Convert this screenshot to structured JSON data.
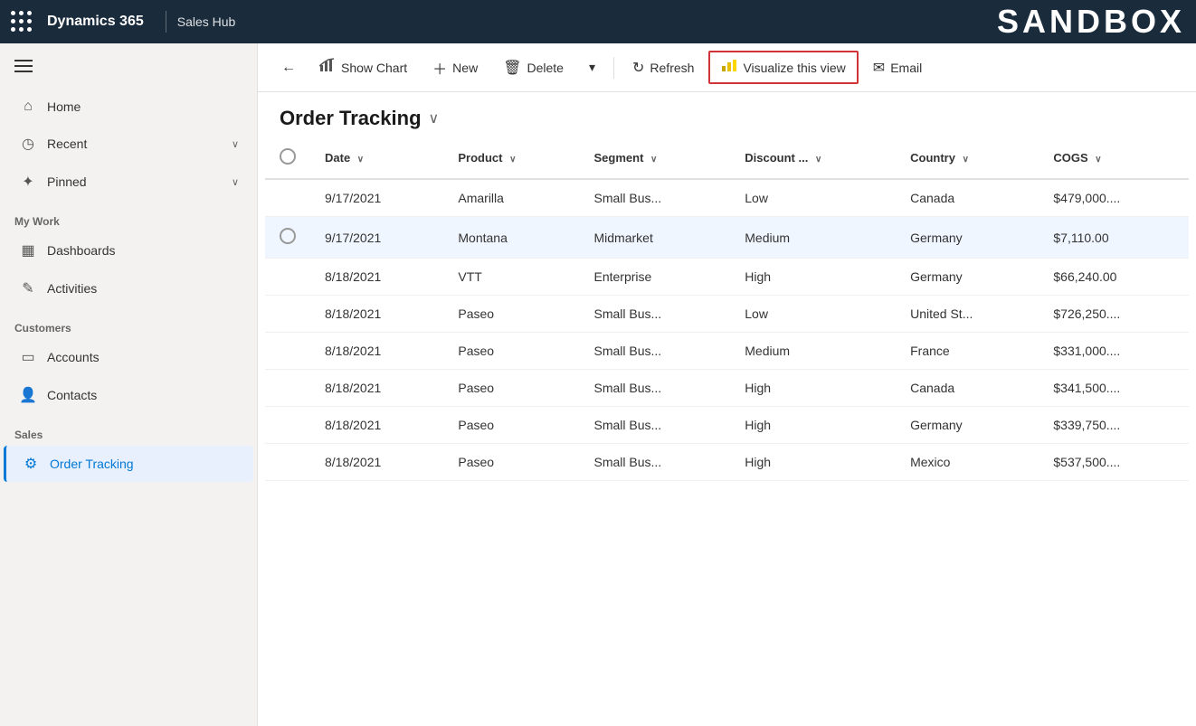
{
  "topbar": {
    "app_name": "Dynamics 365",
    "module_name": "Sales Hub",
    "sandbox_label": "SANDBOX"
  },
  "sidebar": {
    "hamburger_label": "Menu",
    "items": [
      {
        "id": "home",
        "label": "Home",
        "icon": "⌂",
        "has_chevron": false
      },
      {
        "id": "recent",
        "label": "Recent",
        "icon": "◷",
        "has_chevron": true
      },
      {
        "id": "pinned",
        "label": "Pinned",
        "icon": "✦",
        "has_chevron": true
      }
    ],
    "my_work_label": "My Work",
    "my_work_items": [
      {
        "id": "dashboards",
        "label": "Dashboards",
        "icon": "▦",
        "has_chevron": false
      },
      {
        "id": "activities",
        "label": "Activities",
        "icon": "✎",
        "has_chevron": false
      }
    ],
    "customers_label": "Customers",
    "customers_items": [
      {
        "id": "accounts",
        "label": "Accounts",
        "icon": "▭",
        "has_chevron": false
      },
      {
        "id": "contacts",
        "label": "Contacts",
        "icon": "👤",
        "has_chevron": false
      }
    ],
    "sales_label": "Sales",
    "sales_items": [
      {
        "id": "order-tracking",
        "label": "Order Tracking",
        "icon": "⚙",
        "is_active": true
      }
    ]
  },
  "toolbar": {
    "back_icon": "←",
    "show_chart_label": "Show Chart",
    "new_label": "New",
    "delete_label": "Delete",
    "dropdown_icon": "▾",
    "refresh_label": "Refresh",
    "visualize_label": "Visualize this view",
    "email_label": "Email"
  },
  "page": {
    "title": "Order Tracking",
    "title_chevron": "∨"
  },
  "table": {
    "columns": [
      {
        "id": "checkbox",
        "label": ""
      },
      {
        "id": "date",
        "label": "Date",
        "has_sort": true
      },
      {
        "id": "product",
        "label": "Product",
        "has_sort": true
      },
      {
        "id": "segment",
        "label": "Segment",
        "has_sort": true
      },
      {
        "id": "discount",
        "label": "Discount ...",
        "has_sort": true
      },
      {
        "id": "country",
        "label": "Country",
        "has_sort": true
      },
      {
        "id": "cogs",
        "label": "COGS",
        "has_sort": true
      }
    ],
    "rows": [
      {
        "id": 1,
        "checkbox": false,
        "date": "9/17/2021",
        "product": "Amarilla",
        "segment": "Small Bus...",
        "discount": "Low",
        "country": "Canada",
        "cogs": "$479,000...."
      },
      {
        "id": 2,
        "checkbox": true,
        "date": "9/17/2021",
        "product": "Montana",
        "segment": "Midmarket",
        "discount": "Medium",
        "country": "Germany",
        "cogs": "$7,110.00"
      },
      {
        "id": 3,
        "checkbox": false,
        "date": "8/18/2021",
        "product": "VTT",
        "segment": "Enterprise",
        "discount": "High",
        "country": "Germany",
        "cogs": "$66,240.00"
      },
      {
        "id": 4,
        "checkbox": false,
        "date": "8/18/2021",
        "product": "Paseo",
        "segment": "Small Bus...",
        "discount": "Low",
        "country": "United St...",
        "cogs": "$726,250...."
      },
      {
        "id": 5,
        "checkbox": false,
        "date": "8/18/2021",
        "product": "Paseo",
        "segment": "Small Bus...",
        "discount": "Medium",
        "country": "France",
        "cogs": "$331,000...."
      },
      {
        "id": 6,
        "checkbox": false,
        "date": "8/18/2021",
        "product": "Paseo",
        "segment": "Small Bus...",
        "discount": "High",
        "country": "Canada",
        "cogs": "$341,500...."
      },
      {
        "id": 7,
        "checkbox": false,
        "date": "8/18/2021",
        "product": "Paseo",
        "segment": "Small Bus...",
        "discount": "High",
        "country": "Germany",
        "cogs": "$339,750...."
      },
      {
        "id": 8,
        "checkbox": false,
        "date": "8/18/2021",
        "product": "Paseo",
        "segment": "Small Bus...",
        "discount": "High",
        "country": "Mexico",
        "cogs": "$537,500...."
      }
    ]
  }
}
